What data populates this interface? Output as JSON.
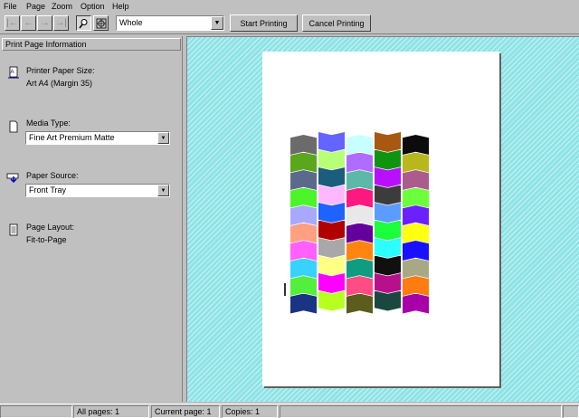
{
  "menubar": {
    "items": [
      {
        "label": "File",
        "mnemonic": "F"
      },
      {
        "label": "Page",
        "mnemonic": "P"
      },
      {
        "label": "Zoom",
        "mnemonic": "Z"
      },
      {
        "label": "Option",
        "mnemonic": "O"
      },
      {
        "label": "Help",
        "mnemonic": "H"
      }
    ]
  },
  "toolbar": {
    "first_icon": "first-page-icon",
    "prev_icon": "previous-page-icon",
    "next_icon": "next-page-icon",
    "last_icon": "last-page-icon",
    "zoom_mode_selected": "Whole",
    "start_label": "Start Printing",
    "cancel_label": "Cancel Printing"
  },
  "panel": {
    "title": "Print Page Information",
    "paper_size_label": "Printer Paper Size:",
    "paper_size_value": "Art A4 (Margin 35)",
    "media_type_label": "Media Type:",
    "media_type_value": "Fine Art Premium Matte",
    "paper_source_label": "Paper Source:",
    "paper_source_value": "Front Tray",
    "page_layout_label": "Page Layout:",
    "page_layout_value": "Fit-to-Page"
  },
  "status": {
    "all_pages": "All pages:  1",
    "current_page": "Current page:  1",
    "copies": "Copies:  1"
  },
  "colors": {
    "preview_background": "#8ee3e6",
    "chrome": "#c0c0c0"
  },
  "patches": [
    [
      "#6b6b6b",
      "#5aa61c",
      "#5b6a8c",
      "#4cf42a",
      "#a8a8ff",
      "#ffa080",
      "#ff60ff",
      "#38d2ff",
      "#54ee3c",
      "#1a3484"
    ],
    [
      "#6464ff",
      "#b8ff78",
      "#1c5c7c",
      "#ffb8ff",
      "#1e62ff",
      "#b00000",
      "#a8a8a8",
      "#ffff84",
      "#ff00ff",
      "#b8ff20"
    ],
    [
      "#c8ffff",
      "#b06cff",
      "#5cb8a8",
      "#ff1880",
      "#e8e8e8",
      "#64009c",
      "#ff8410",
      "#109c80",
      "#ff4c84",
      "#5c5c1c"
    ],
    [
      "#a85810",
      "#109410",
      "#b810ff",
      "#3c3c3c",
      "#5c9cff",
      "#1cff3c",
      "#2cffff",
      "#101010",
      "#b8108c",
      "#1a4840"
    ],
    [
      "#0c0c0c",
      "#b8b81c",
      "#ac5c8c",
      "#6cff3c",
      "#6c20ff",
      "#ffff10",
      "#1810ff",
      "#a8a884",
      "#ff7c10",
      "#a800a8"
    ]
  ]
}
